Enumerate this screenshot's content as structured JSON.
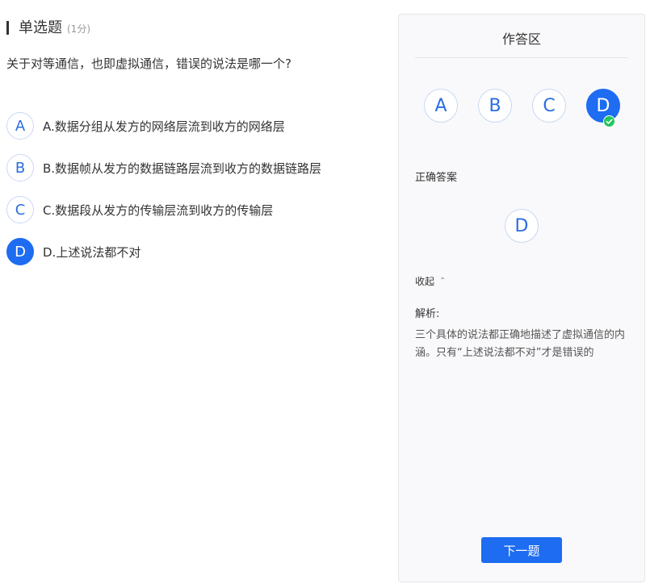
{
  "question": {
    "type_label": "单选题",
    "score_label": "(1分)",
    "stem": "关于对等通信，也即虚拟通信，错误的说法是哪一个?",
    "options": [
      {
        "letter": "A",
        "text": "A.数据分组从发方的网络层流到收方的网络层",
        "selected": false
      },
      {
        "letter": "B",
        "text": "B.数据帧从发方的数据链路层流到收方的数据链路层",
        "selected": false
      },
      {
        "letter": "C",
        "text": "C.数据段从发方的传输层流到收方的传输层",
        "selected": false
      },
      {
        "letter": "D",
        "text": "D.上述说法都不对",
        "selected": true
      }
    ]
  },
  "panel": {
    "title": "作答区",
    "answer_choices": [
      "A",
      "B",
      "C",
      "D"
    ],
    "selected_choice": "D",
    "correct_label": "正确答案",
    "correct_answer": "D",
    "collapse_label": "收起",
    "analysis_label": "解析:",
    "analysis_text": "三个具体的说法都正确地描述了虚拟通信的内涵。只有“上述说法都不对”才是错误的",
    "next_button": "下一题"
  },
  "colors": {
    "accent": "#1d6cf2",
    "correct_badge": "#22c55e",
    "option_border": "#c9d8f4"
  }
}
